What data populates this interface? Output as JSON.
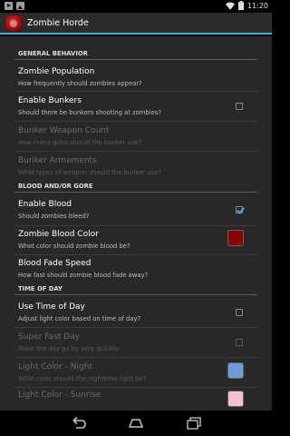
{
  "statusbar": {
    "time": "11:20"
  },
  "app": {
    "title": "Zombie Horde"
  },
  "headers": {
    "general": "GENERAL BEHAVIOR",
    "blood": "BLOOD AND/OR GORE",
    "time": "TIME OF DAY"
  },
  "prefs": {
    "population": {
      "title": "Zombie Population",
      "summary": "How frequently should zombies appear?"
    },
    "bunkers": {
      "title": "Enable Bunkers",
      "summary": "Should there be bunkers shooting at zombies?",
      "checked": false
    },
    "weapon_count": {
      "title": "Bunker Weapon Count",
      "summary": "How many guns should the bunker use?"
    },
    "armaments": {
      "title": "Bunker Armaments",
      "summary": "What types of weapon should the bunker use?"
    },
    "enable_blood": {
      "title": "Enable Blood",
      "summary": "Should zombies bleed?",
      "checked": true
    },
    "blood_color": {
      "title": "Zombie Blood Color",
      "summary": "What color should zombie blood be?",
      "color": "#8b0000"
    },
    "fade_speed": {
      "title": "Blood Fade Speed",
      "summary": "How fast should zombie blood fade away?"
    },
    "use_time": {
      "title": "Use Time of Day",
      "summary": "Adjust light color based on time of day?",
      "checked": false
    },
    "super_fast": {
      "title": "Super Fast Day",
      "summary": "Make the day go by very quickly.",
      "checked": false
    },
    "night_color": {
      "title": "Light Color - Night",
      "summary": "What color should the nighttime light be?",
      "color": "#6f9bdc"
    },
    "sunrise_color": {
      "title": "Light Color - Sunrise",
      "color": "#f3c0d5"
    }
  },
  "colors": {
    "accent": "#33b5e5",
    "background": "#282828"
  }
}
